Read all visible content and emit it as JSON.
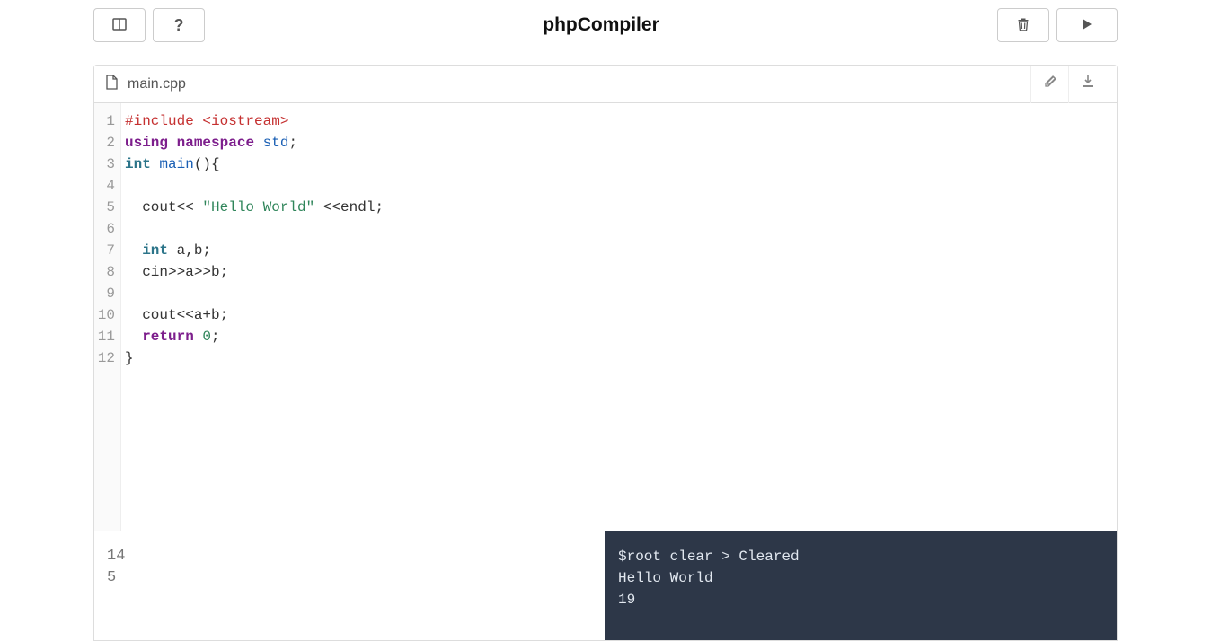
{
  "header": {
    "title": "phpCompiler",
    "help_label": "?"
  },
  "file": {
    "name": "main.cpp"
  },
  "code": {
    "lines": [
      {
        "n": "1",
        "tokens": [
          {
            "t": "meta",
            "v": "#include <iostream>"
          }
        ]
      },
      {
        "n": "2",
        "tokens": [
          {
            "t": "keyword",
            "v": "using"
          },
          {
            "t": "plain",
            "v": " "
          },
          {
            "t": "keyword",
            "v": "namespace"
          },
          {
            "t": "plain",
            "v": " "
          },
          {
            "t": "ident",
            "v": "std"
          },
          {
            "t": "plain",
            "v": ";"
          }
        ]
      },
      {
        "n": "3",
        "tokens": [
          {
            "t": "type",
            "v": "int"
          },
          {
            "t": "plain",
            "v": " "
          },
          {
            "t": "func",
            "v": "main"
          },
          {
            "t": "plain",
            "v": "(){"
          }
        ]
      },
      {
        "n": "4",
        "tokens": []
      },
      {
        "n": "5",
        "tokens": [
          {
            "t": "plain",
            "v": "  cout<< "
          },
          {
            "t": "string",
            "v": "\"Hello World\""
          },
          {
            "t": "plain",
            "v": " <<endl;"
          }
        ]
      },
      {
        "n": "6",
        "tokens": []
      },
      {
        "n": "7",
        "tokens": [
          {
            "t": "plain",
            "v": "  "
          },
          {
            "t": "type",
            "v": "int"
          },
          {
            "t": "plain",
            "v": " a,b;"
          }
        ]
      },
      {
        "n": "8",
        "tokens": [
          {
            "t": "plain",
            "v": "  cin>>a>>b;"
          }
        ]
      },
      {
        "n": "9",
        "tokens": []
      },
      {
        "n": "10",
        "tokens": [
          {
            "t": "plain",
            "v": "  cout<<a+b;"
          }
        ]
      },
      {
        "n": "11",
        "tokens": [
          {
            "t": "plain",
            "v": "  "
          },
          {
            "t": "keyword",
            "v": "return"
          },
          {
            "t": "plain",
            "v": " "
          },
          {
            "t": "num",
            "v": "0"
          },
          {
            "t": "plain",
            "v": ";"
          }
        ]
      },
      {
        "n": "12",
        "tokens": [
          {
            "t": "plain",
            "v": "}"
          }
        ]
      }
    ]
  },
  "input_panel": "14\n5",
  "output_panel": "$root clear > Cleared\nHello World\n19"
}
